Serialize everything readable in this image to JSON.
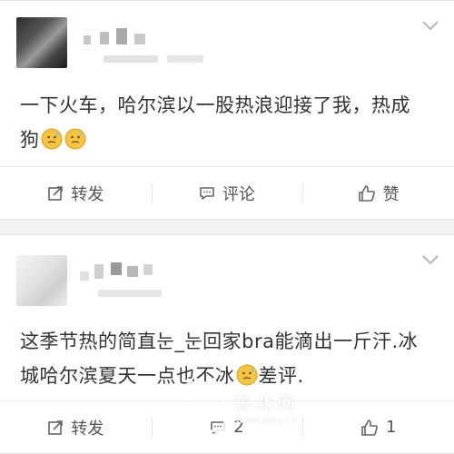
{
  "posts": [
    {
      "text_line1": "一下火车，哈尔滨以一股热浪迎接了我，热成",
      "text_line2": "狗",
      "emoji": [
        "sweat-face-emoji",
        "sweat-face-emoji"
      ],
      "actions": {
        "repost": "转发",
        "comment": "评论",
        "like": "赞"
      }
    },
    {
      "text_line1": "这季节热的简直눈_눈回家bra能滴出一斤汗.冰",
      "text_line2a": "城哈尔滨夏天一点也不冰",
      "text_line2b": "差评.",
      "emoji": [
        "sweat-face-emoji"
      ],
      "actions": {
        "repost": "转发",
        "comment": "2",
        "like": "1"
      }
    }
  ],
  "watermark": {
    "brand": "东北网",
    "url": "www.dbw.cn"
  },
  "colors": {
    "background": "#f2f2f2",
    "card": "#ffffff",
    "text": "#333333",
    "icon": "#666666",
    "emoji": "#f5c542"
  }
}
